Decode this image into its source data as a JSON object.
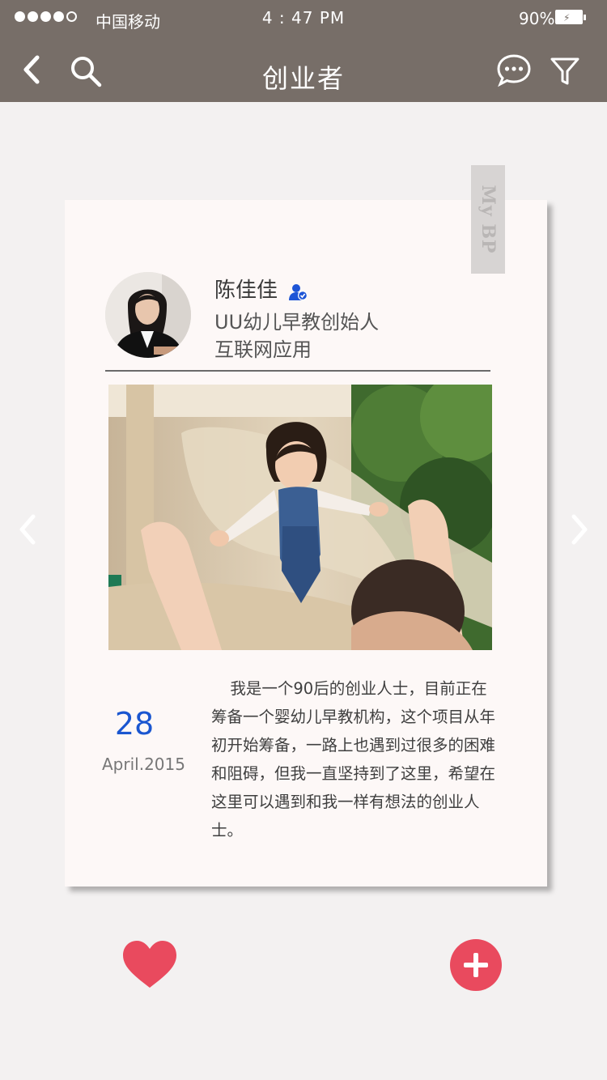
{
  "status_bar": {
    "carrier": "中国移动",
    "time": "4 : 47 PM",
    "battery": "90%"
  },
  "nav": {
    "title": "创业者"
  },
  "card": {
    "tag": "My BP",
    "profile": {
      "name": "陈佳佳",
      "company": "UU幼儿早教创始人",
      "industry": "互联网应用"
    },
    "date": {
      "day": "28",
      "month_year": "April.2015"
    },
    "description": "我是一个90后的创业人士，目前正在筹备一个婴幼儿早教机构，这个项目从年初开始筹备，一路上也遇到过很多的困难和阻碍，但我一直坚持到了这里，希望在这里可以遇到和我一样有想法的创业人士。"
  },
  "colors": {
    "nav_bar": "#776e68",
    "accent_red": "#e94a5e",
    "date_blue": "#1a56d0",
    "card_bg": "#fdf8f7",
    "page_bg": "#f3f1f1"
  }
}
